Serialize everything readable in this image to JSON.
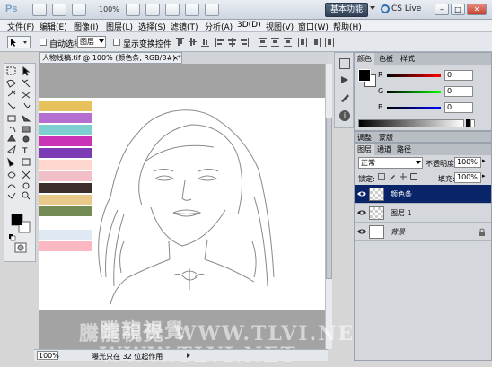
{
  "titlebar": {
    "app_icon": "Ps",
    "zoom": "100%",
    "workspace_button": "基本功能",
    "cslive": "CS Live"
  },
  "menu": [
    "文件(F)",
    "编辑(E)",
    "图像(I)",
    "图层(L)",
    "选择(S)",
    "滤镜(T)",
    "分析(A)",
    "3D(D)",
    "视图(V)",
    "窗口(W)",
    "帮助(H)"
  ],
  "options": {
    "auto_select_label": "自动选择:",
    "auto_select_value": "图层",
    "show_transform_label": "显示变换控件"
  },
  "document": {
    "tab_title": "人物线稿.tif @ 100% (颜色条, RGB/8#) *",
    "zoom": "100%",
    "status_text": "曝光只在 32 位起作用",
    "watermark": "騰龍視覺  WWW.TLVI.NET"
  },
  "swatches": [
    "#e7c25c",
    "#b56fd1",
    "#7ecfd0",
    "#c933b5",
    "#7a3bb5",
    "#ffd7cf",
    "#f2bfc9",
    "#3b2e2b",
    "#e8c98a",
    "#758b55",
    "#ffffff",
    "#dfe9f3",
    "#fbb8c3"
  ],
  "colors": {
    "foreground": "#000000",
    "background": "#ffffff",
    "accent": "#0a246a"
  },
  "color_panel": {
    "tabs": [
      "颜色",
      "色板",
      "样式"
    ],
    "r_label": "R",
    "g_label": "G",
    "b_label": "B",
    "r_value": "0",
    "g_value": "0",
    "b_value": "0"
  },
  "adjust_tabs": [
    "调整",
    "蒙版"
  ],
  "layers_panel": {
    "tabs": [
      "图层",
      "通道",
      "路径"
    ],
    "blend_mode": "正常",
    "opacity_label": "不透明度:",
    "opacity_value": "100%",
    "lock_label": "锁定:",
    "fill_label": "填充:",
    "fill_value": "100%",
    "layers": [
      {
        "name": "颜色条",
        "selected": true
      },
      {
        "name": "图层 1",
        "selected": false
      },
      {
        "name": "背景",
        "selected": false
      }
    ]
  }
}
